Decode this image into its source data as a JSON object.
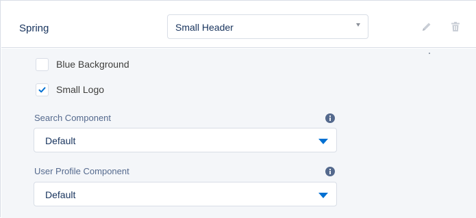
{
  "theme": {
    "name": "Spring",
    "header_select": {
      "value": "Small Header"
    },
    "edit_icon": "pencil-icon",
    "delete_icon": "trash-icon"
  },
  "options": {
    "blue_background": {
      "label": "Blue Background",
      "checked": false
    },
    "small_logo": {
      "label": "Small Logo",
      "checked": true
    }
  },
  "fields": {
    "search_component": {
      "label": "Search Component",
      "value": "Default",
      "info_icon": "info-icon"
    },
    "user_profile_component": {
      "label": "User Profile Component",
      "value": "Default",
      "info_icon": "info-icon"
    }
  },
  "colors": {
    "accent": "#0070d2",
    "panel_bg": "#f4f6f9",
    "border": "#d8dde6",
    "icon_muted": "#c9ced6",
    "info_icon": "#54698d"
  }
}
